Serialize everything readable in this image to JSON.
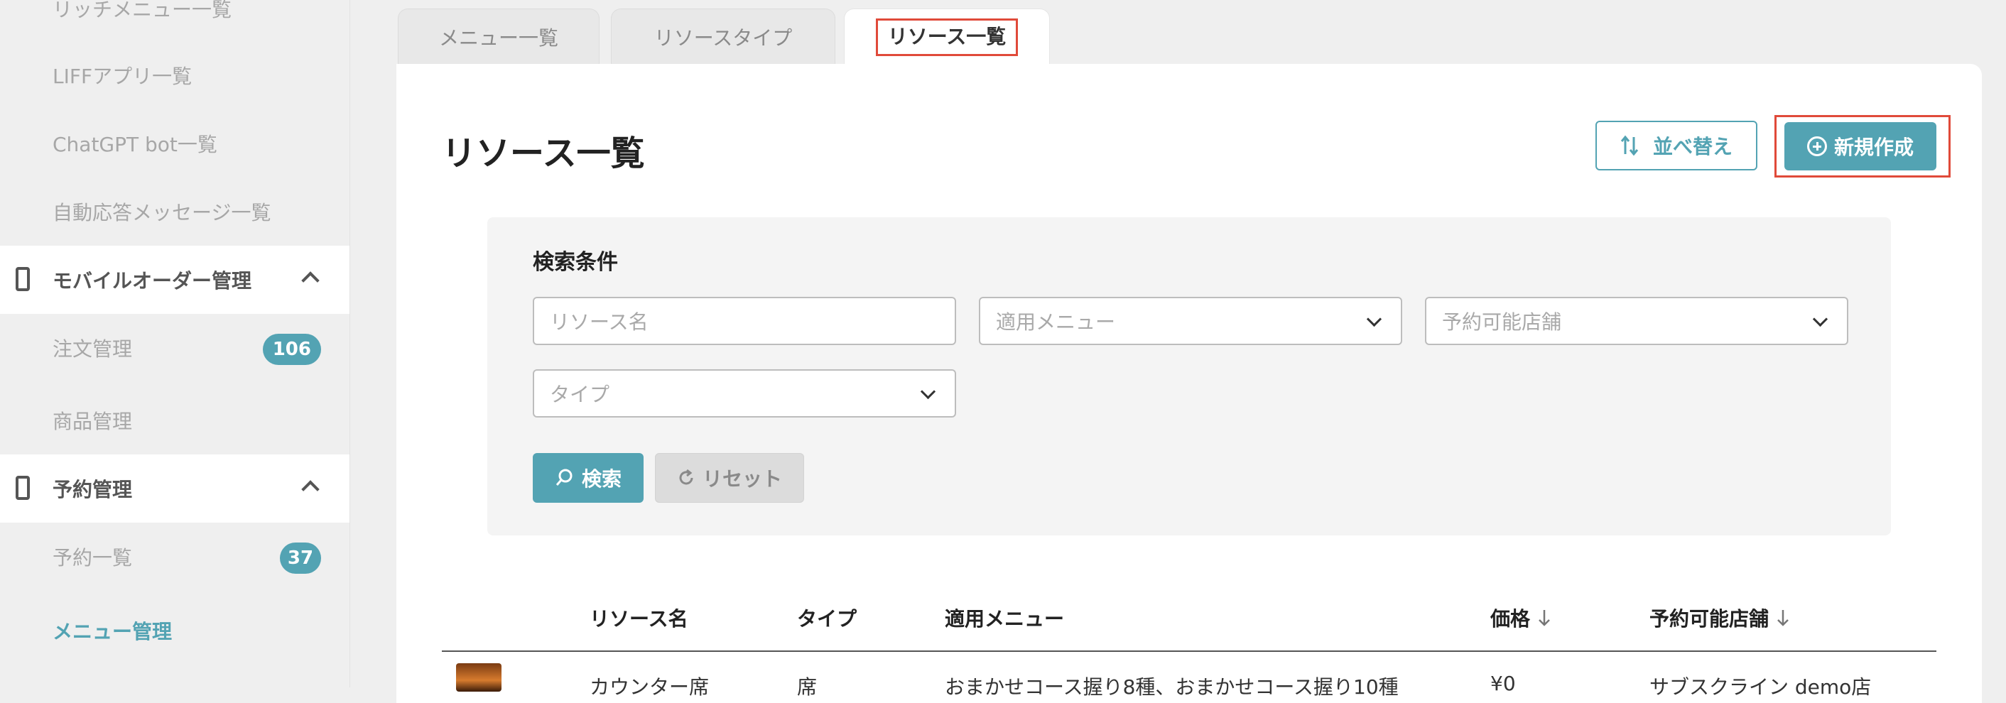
{
  "sidebar": {
    "items": [
      {
        "label": "リッチメニュー一覧"
      },
      {
        "label": "LIFFアプリ一覧"
      },
      {
        "label": "ChatGPT bot一覧"
      },
      {
        "label": "自動応答メッセージ一覧"
      }
    ],
    "section_mobile_order": {
      "label": "モバイルオーダー管理",
      "children": [
        {
          "label": "注文管理",
          "badge": "106"
        },
        {
          "label": "商品管理"
        }
      ]
    },
    "section_reservation": {
      "label": "予約管理",
      "children": [
        {
          "label": "予約一覧",
          "badge": "37"
        },
        {
          "label": "メニュー管理",
          "active": true
        }
      ]
    }
  },
  "tabs": [
    {
      "label": "メニュー一覧"
    },
    {
      "label": "リソースタイプ"
    },
    {
      "label": "リソース一覧",
      "active": true
    }
  ],
  "page": {
    "title": "リソース一覧",
    "sort_label": "並べ替え",
    "new_label": "新規作成"
  },
  "search": {
    "heading": "検索条件",
    "resource_name_placeholder": "リソース名",
    "menu_placeholder": "適用メニュー",
    "store_placeholder": "予約可能店舗",
    "type_placeholder": "タイプ",
    "search_label": "検索",
    "reset_label": "リセット"
  },
  "table": {
    "headers": {
      "name": "リソース名",
      "type": "タイプ",
      "menu": "適用メニュー",
      "price": "価格",
      "store": "予約可能店舗"
    },
    "rows": [
      {
        "name": "カウンター席",
        "type": "席",
        "menu": "おまかせコース握り8種、おまかせコース握り10種",
        "price": "¥0",
        "store": "サブスクライン demo店"
      }
    ]
  },
  "colors": {
    "accent": "#53a3b3",
    "highlight": "#e04a3a",
    "background": "#efefef"
  }
}
